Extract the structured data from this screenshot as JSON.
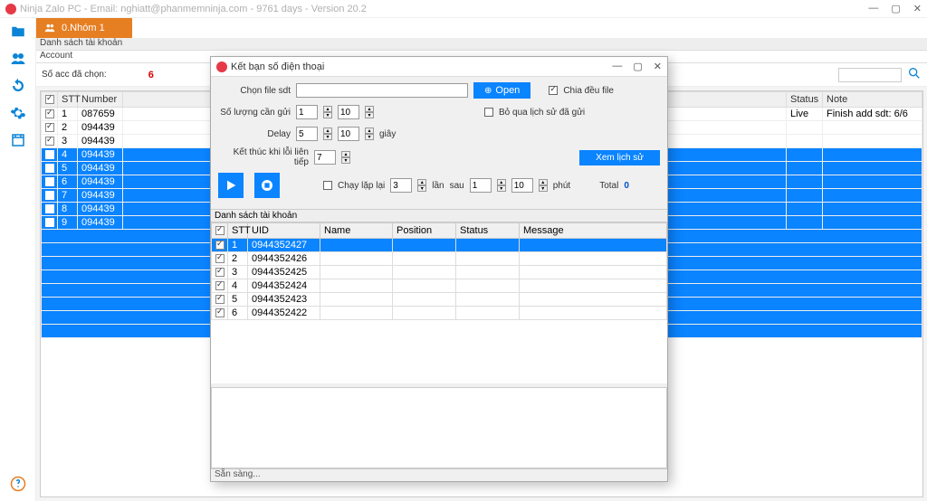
{
  "window": {
    "title": "Ninja Zalo PC - Email: nghiatt@phanmemninja.com - 9761 days - Version 20.2",
    "min": "—",
    "max": "▢",
    "close": "✕"
  },
  "tabs": [
    {
      "label": "0.Nhóm 1"
    }
  ],
  "crumb1": "Danh sách tài khoản",
  "crumb2": "Account",
  "toolbar": {
    "selected_label": "Số acc đã chọn:",
    "selected_count": "6"
  },
  "main_grid": {
    "headers": {
      "stt": "STT",
      "number": "Number",
      "status": "Status",
      "note": "Note"
    },
    "rows": [
      {
        "stt": "1",
        "number": "087659",
        "checked": true,
        "sel": false,
        "status": "Live",
        "note": "Finish add sdt: 6/6"
      },
      {
        "stt": "2",
        "number": "094439",
        "checked": true,
        "sel": false,
        "status": "",
        "note": ""
      },
      {
        "stt": "3",
        "number": "094439",
        "checked": true,
        "sel": false,
        "status": "",
        "note": ""
      },
      {
        "stt": "4",
        "number": "094439",
        "checked": true,
        "sel": true,
        "status": "",
        "note": ""
      },
      {
        "stt": "5",
        "number": "094439",
        "checked": true,
        "sel": true,
        "status": "",
        "note": ""
      },
      {
        "stt": "6",
        "number": "094439",
        "checked": true,
        "sel": true,
        "status": "",
        "note": ""
      },
      {
        "stt": "7",
        "number": "094439",
        "checked": true,
        "sel": true,
        "status": "",
        "note": ""
      },
      {
        "stt": "8",
        "number": "094439",
        "checked": true,
        "sel": true,
        "status": "",
        "note": ""
      },
      {
        "stt": "9",
        "number": "094439",
        "checked": true,
        "sel": true,
        "status": "",
        "note": ""
      }
    ]
  },
  "dialog": {
    "title": "Kết bạn số điện thoại",
    "labels": {
      "chon_file": "Chọn file sdt",
      "open_btn": "Open",
      "chia_file": "Chia đều file",
      "so_luong": "Số lượng cần gửi",
      "bo_qua": "Bỏ qua lịch sử đã gửi",
      "delay": "Delay",
      "delay_unit": "giây",
      "ket_thuc": "Kết thúc khi lỗi liên tiếp",
      "history": "Xem lịch sử",
      "chay_lap": "Chạy lặp lại",
      "lan": "lần",
      "sau": "sau",
      "phut": "phút",
      "total_lbl": "Total",
      "total_val": "0",
      "section": "Danh sách tài khoản",
      "status": "Sẵn sàng..."
    },
    "nums": {
      "sl1": "1",
      "sl2": "10",
      "d1": "5",
      "d2": "10",
      "kt": "7",
      "ll1": "3",
      "ll2": "1",
      "ll3": "10"
    },
    "grid_headers": {
      "stt": "STT",
      "uid": "UID",
      "name": "Name",
      "position": "Position",
      "status": "Status",
      "message": "Message"
    },
    "grid_rows": [
      {
        "stt": "1",
        "uid": "0944352427",
        "sel": true
      },
      {
        "stt": "2",
        "uid": "0944352426",
        "sel": false
      },
      {
        "stt": "3",
        "uid": "0944352425",
        "sel": false
      },
      {
        "stt": "4",
        "uid": "0944352424",
        "sel": false
      },
      {
        "stt": "5",
        "uid": "0944352423",
        "sel": false
      },
      {
        "stt": "6",
        "uid": "0944352422",
        "sel": false
      }
    ]
  }
}
